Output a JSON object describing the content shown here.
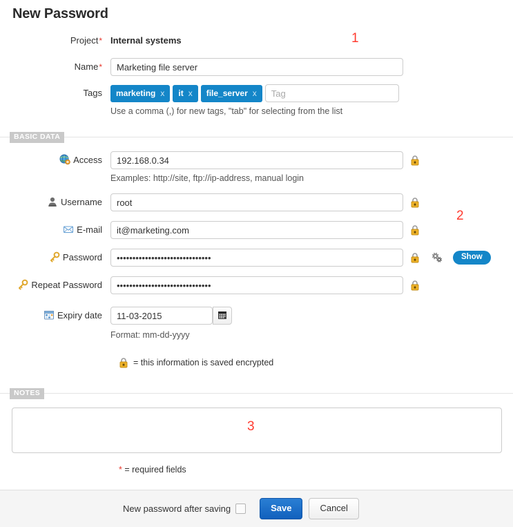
{
  "header": {
    "title": "New Password"
  },
  "form": {
    "project": {
      "label": "Project",
      "required": true,
      "value": "Internal systems"
    },
    "name": {
      "label": "Name",
      "required": true,
      "value": "Marketing file server"
    },
    "tags": {
      "label": "Tags",
      "items": [
        {
          "text": "marketing",
          "remove": "x"
        },
        {
          "text": "it",
          "remove": "x"
        },
        {
          "text": "file_server",
          "remove": "x"
        }
      ],
      "input_placeholder": "Tag",
      "input_value": "",
      "hint": "Use a comma (,) for new tags, \"tab\" for selecting from the list"
    }
  },
  "sections": {
    "basic_data": {
      "title": "BASIC DATA"
    },
    "notes": {
      "title": "NOTES"
    }
  },
  "basic": {
    "access": {
      "label": "Access",
      "icon": "globe-icon",
      "value": "192.168.0.34",
      "hint": "Examples: http://site, ftp://ip-address, manual login",
      "encrypted": true
    },
    "username": {
      "label": "Username",
      "icon": "user-icon",
      "value": "root",
      "encrypted": true
    },
    "email": {
      "label": "E-mail",
      "icon": "envelope-icon",
      "value": "it@marketing.com",
      "encrypted": true
    },
    "password": {
      "label": "Password",
      "icon": "key-icon",
      "value": "••••••••••••••••••••••••••••••",
      "encrypted": true,
      "generator_icon": "gears-icon",
      "show_label": "Show"
    },
    "repeat_password": {
      "label": "Repeat Password",
      "icon": "key-icon",
      "value": "••••••••••••••••••••••••••••••",
      "encrypted": true
    },
    "expiry": {
      "label": "Expiry date",
      "icon": "calendar-date-icon",
      "value": "11-03-2015",
      "picker_icon": "calendar-icon",
      "hint": "Format: mm-dd-yyyy"
    },
    "encrypted_note": {
      "icon": "lock-icon",
      "text": "= this information is saved encrypted"
    }
  },
  "notes": {
    "value": "",
    "placeholder": ""
  },
  "required_note": {
    "marker": "*",
    "text": "= required fields"
  },
  "footer": {
    "checkbox_label": "New password after saving",
    "checkbox_checked": false,
    "save_label": "Save",
    "cancel_label": "Cancel"
  },
  "annotations": [
    {
      "id": "1",
      "text": "1"
    },
    {
      "id": "2",
      "text": "2"
    },
    {
      "id": "3",
      "text": "3"
    }
  ],
  "colors": {
    "tag_blue": "#1486c8",
    "save_blue": "#1569c7",
    "required_red": "#e8372c",
    "annotation_red": "#ff3b30",
    "section_chip_gray": "#c9c9c9",
    "footer_gray": "#f5f5f5"
  }
}
